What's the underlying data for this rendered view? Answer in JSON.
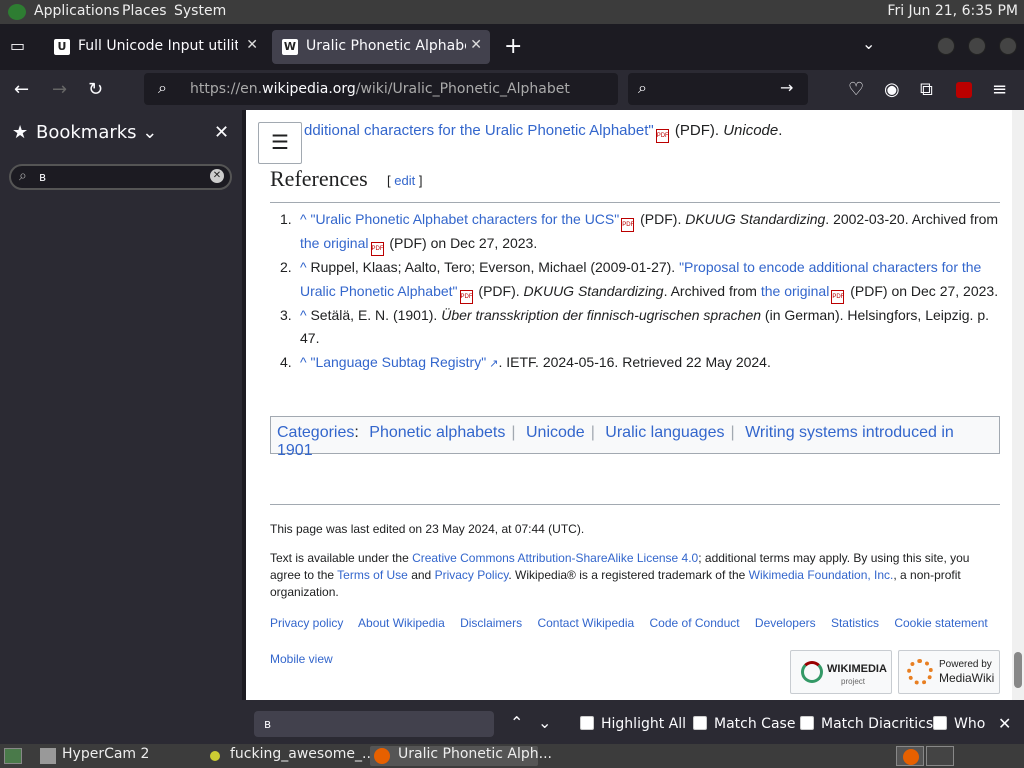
{
  "top_panel": {
    "menus": [
      "Applications",
      "Places",
      "System"
    ],
    "clock": "Fri Jun 21,  6:35 PM"
  },
  "tabs": [
    {
      "title": "Full Unicode Input utility",
      "favicon": "U"
    },
    {
      "title": "Uralic Phonetic Alphabet - W",
      "favicon": "W"
    }
  ],
  "url": {
    "prefix": "https://en.",
    "domain": "wikipedia.org",
    "path": "/wiki/Uralic_Phonetic_Alphabet"
  },
  "sidebar": {
    "title": "Bookmarks",
    "search_value": "в"
  },
  "page": {
    "top_fragment": "dditional characters for the Uralic Phonetic Alphabet\"",
    "top_fragment_suffix": " (PDF). ",
    "top_fragment_italic": "Unicode",
    "references_heading": "References",
    "edit_label": "edit",
    "refs": [
      {
        "num": "1.",
        "pre": "",
        "link": "\"Uralic Phonetic Alphabet characters for the UCS\"",
        "mid": " (PDF). ",
        "italic": "DKUUG Standardizing",
        "post": ". 2002-03-20. Archived from ",
        "link2": "the original",
        "end": " (PDF) on Dec 27, 2023."
      },
      {
        "num": "2.",
        "pre": "Ruppel, Klaas; Aalto, Tero; Everson, Michael (2009-01-27). ",
        "link": "\"Proposal to encode additional characters for the Uralic Phonetic Alphabet\"",
        "mid": " (PDF). ",
        "italic": "DKUUG Standardizing",
        "post": ". Archived from ",
        "link2": "the original",
        "end": " (PDF) on Dec 27, 2023."
      },
      {
        "num": "3.",
        "pre": "Setälä, E. N. (1901). ",
        "link": "",
        "mid": "",
        "italic": "Über transskription der finnisch-ugrischen sprachen",
        "post": " (in German). Helsingfors, Leipzig. p. 47.",
        "link2": "",
        "end": ""
      },
      {
        "num": "4.",
        "pre": "",
        "link": "\"Language Subtag Registry\"",
        "mid": "",
        "italic": "",
        "post": ". IETF. 2024-05-16. Retrieved 22 May 2024.",
        "link2": "",
        "end": ""
      }
    ],
    "categories_label": "Categories",
    "categories": [
      "Phonetic alphabets",
      "Unicode",
      "Uralic languages",
      "Writing systems introduced in 1901"
    ],
    "last_edited": "This page was last edited on 23 May 2024, at 07:44 (UTC).",
    "license_parts": {
      "a": "Text is available under the ",
      "link1": "Creative Commons Attribution-ShareAlike License 4.0",
      "b": "; additional terms may apply. By using this site, you agree to the ",
      "link2": "Terms of Use",
      "c": " and ",
      "link3": "Privacy Policy",
      "d": ". Wikipedia® is a registered trademark of the ",
      "link4": "Wikimedia Foundation, Inc.",
      "e": ", a non-profit organization."
    },
    "footer_links": [
      "Privacy policy",
      "About Wikipedia",
      "Disclaimers",
      "Contact Wikipedia",
      "Code of Conduct",
      "Developers",
      "Statistics",
      "Cookie statement"
    ],
    "mobile_view": "Mobile view",
    "badge_wikimedia": "WIKIMEDIA",
    "badge_wikimedia_sub": "project",
    "badge_mediawiki_top": "Powered by",
    "badge_mediawiki": "MediaWiki"
  },
  "findbar": {
    "value": "в",
    "options": [
      "Highlight All",
      "Match Case",
      "Match Diacritics",
      "Who"
    ]
  },
  "taskbar": {
    "items": [
      "HyperCam 2",
      "fucking_awesome_...",
      "Uralic Phonetic Alph..."
    ]
  }
}
